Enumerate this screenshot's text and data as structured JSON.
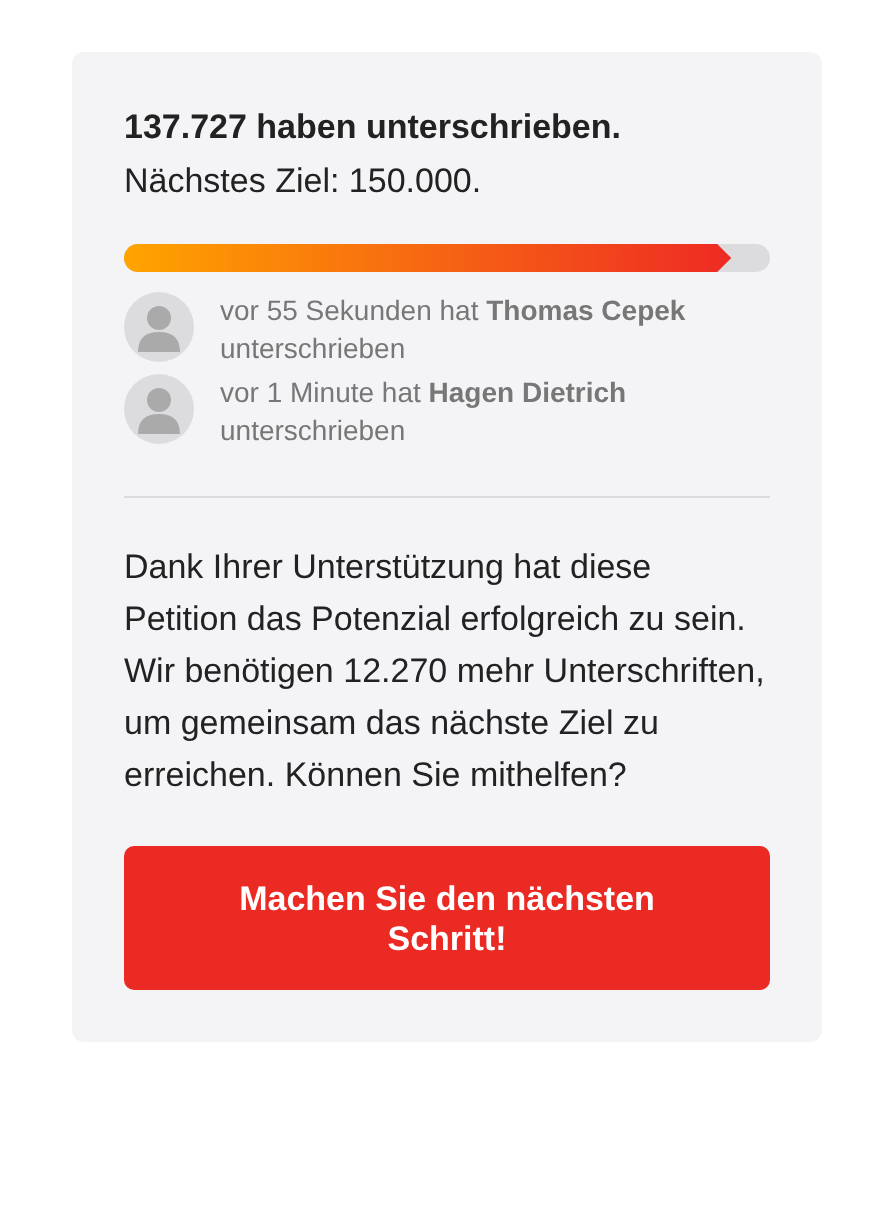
{
  "count_heading": "137.727 haben unterschrieben.",
  "goal": "Nächstes Ziel: 150.000.",
  "progress": {
    "level": 0.94
  },
  "recent_signers": [
    {
      "text": "vor 55 Sekunden hat **Thomas Cepek** unterschrieben"
    },
    {
      "text": "vor 1 Minute hat **Hagen Dietrich** unterschrieben"
    }
  ],
  "message": "Dank Ihrer Unterstützung hat diese Petition das Potenzial erfolgreich zu sein. Wir benötigen 12.270 mehr Unterschriften, um gemeinsam das nächste Ziel zu erreichen. Können Sie mithelfen?",
  "cta_button": "Machen Sie den nächsten Schritt!"
}
